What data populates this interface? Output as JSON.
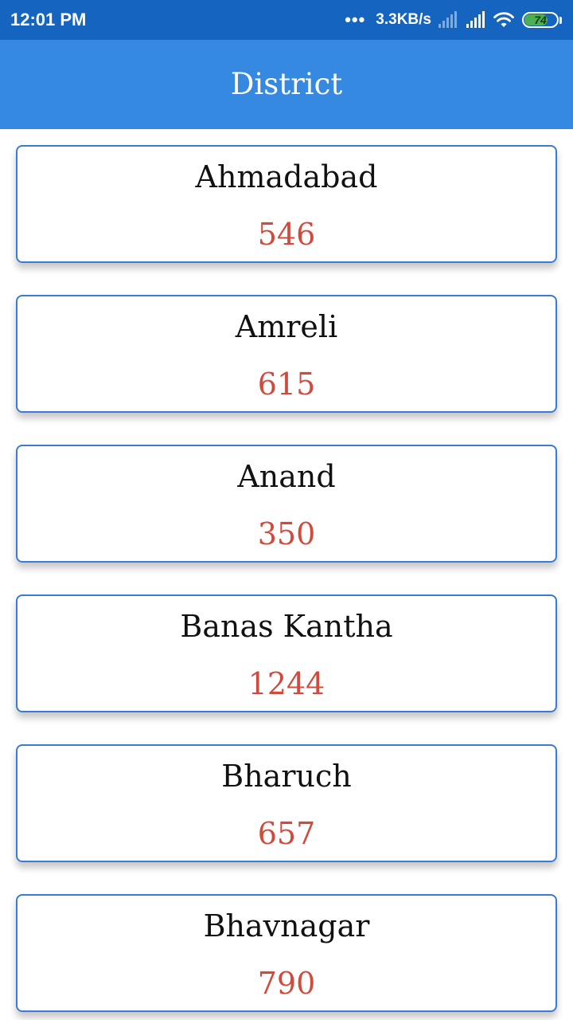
{
  "status_bar": {
    "time": "12:01 PM",
    "network_speed": "3.3KB/s",
    "more_icon": "more-dots-icon",
    "signal_icons": [
      "signal-icon-weak",
      "signal-icon"
    ],
    "wifi_icon": "wifi-icon",
    "battery_level": "74",
    "battery_fraction": 0.74,
    "battery_color": "#4caf50"
  },
  "app_bar": {
    "title": "District",
    "color": "#3689e0"
  },
  "colors": {
    "status_bar": "#1565c0",
    "card_border": "#3a7bd5",
    "count_text": "#d14a3c",
    "name_text": "#111111"
  },
  "districts": [
    {
      "name": "Ahmadabad",
      "count": "546"
    },
    {
      "name": "Amreli",
      "count": "615"
    },
    {
      "name": "Anand",
      "count": "350"
    },
    {
      "name": "Banas Kantha",
      "count": "1244"
    },
    {
      "name": "Bharuch",
      "count": "657"
    },
    {
      "name": "Bhavnagar",
      "count": "790"
    }
  ]
}
